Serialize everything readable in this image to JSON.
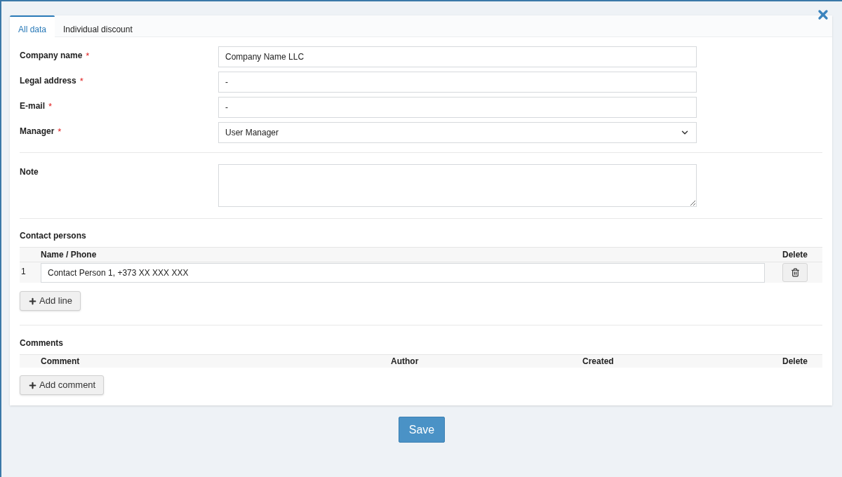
{
  "tabs": [
    {
      "label": "All data",
      "selected": true
    },
    {
      "label": "Individual discount",
      "selected": false
    }
  ],
  "fields": [
    {
      "label": "Company name",
      "required_mark": "*",
      "kind": "input",
      "value": "Company Name LLC"
    },
    {
      "label": "Legal address",
      "required_mark": "*",
      "kind": "input",
      "value": "-"
    },
    {
      "label": "E-mail",
      "required_mark": "*",
      "kind": "input",
      "value": "-"
    },
    {
      "label": "Manager",
      "required_mark": "*",
      "kind": "select",
      "value": "User Manager"
    }
  ],
  "note": {
    "label": "Note"
  },
  "contact_persons": {
    "title": "Contact persons",
    "columns": [
      "Name / Phone",
      "Delete"
    ],
    "rows": [
      {
        "number": "1",
        "value": "Contact Person 1, +373 XX XXX XXX"
      }
    ],
    "add_button": "Add line"
  },
  "comments": {
    "title": "Comments",
    "columns": [
      "Comment",
      "Author",
      "Created",
      "Delete"
    ],
    "add_button": "Add comment"
  },
  "save_button": "Save"
}
